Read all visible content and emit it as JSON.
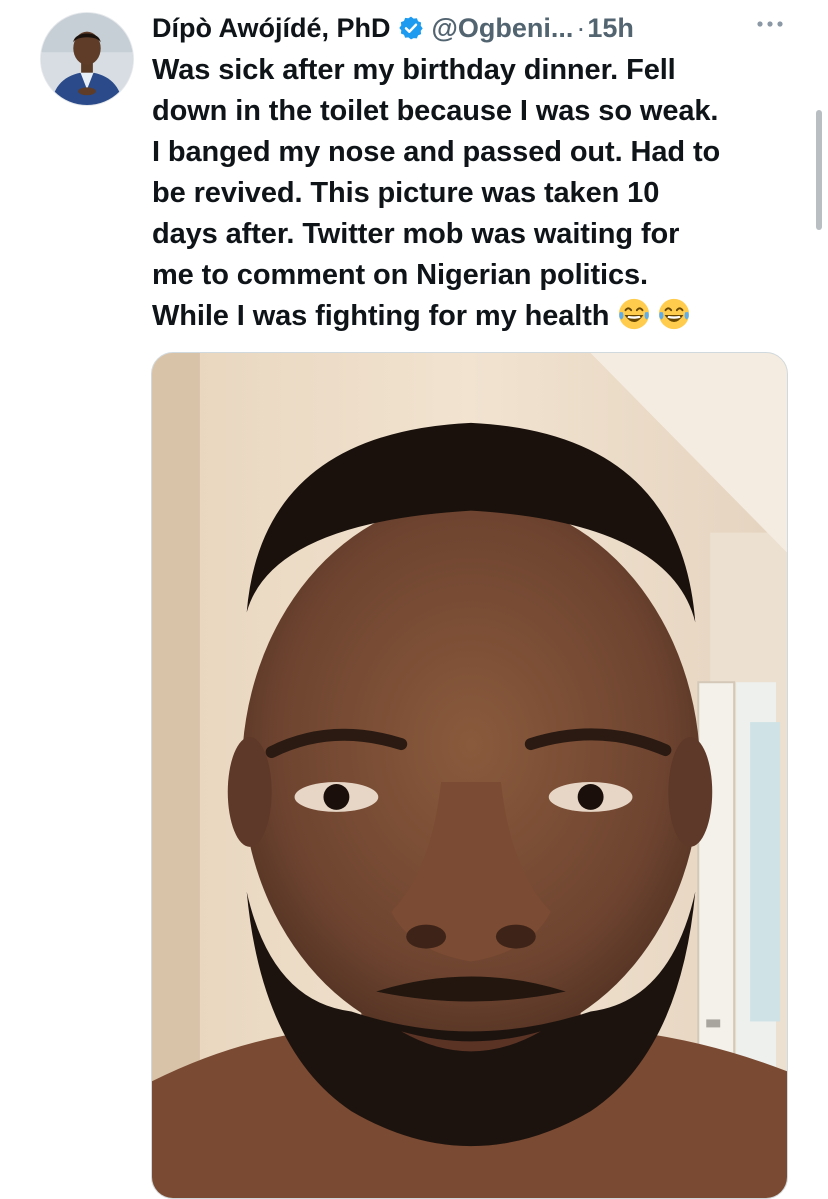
{
  "author": {
    "display_name": "Dípò Awójídé, PhD",
    "handle": "@Ogbeni...",
    "separator": "·",
    "time": "15h",
    "verified": true,
    "verified_color": "#1d9bf0"
  },
  "tweet": {
    "lines": [
      "Was sick after my birthday dinner. Fell",
      "down in the toilet because I was so weak.",
      "I banged my nose and passed out. Had to",
      "be revived. This picture was taken 10",
      "days after. Twitter mob was waiting for",
      "me to comment on Nigerian politics.",
      "While I was fighting for my health"
    ],
    "emojis": [
      "face-with-tears-of-joy-icon",
      "face-with-tears-of-joy-icon"
    ]
  },
  "colors": {
    "text_primary": "#0f1419",
    "text_secondary": "#536471",
    "border": "#cfd9de"
  }
}
